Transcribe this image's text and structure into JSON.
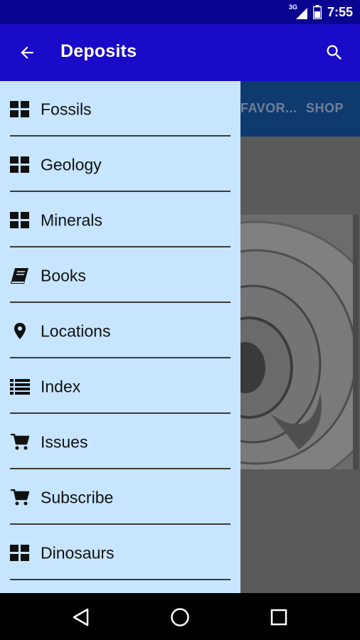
{
  "status_bar": {
    "network_label": "3G",
    "time": "7:55",
    "icons": [
      "signal-icon",
      "battery-icon"
    ]
  },
  "app_bar": {
    "title": "Deposits",
    "back_icon": "arrow-left-icon",
    "search_icon": "search-icon"
  },
  "tabs": [
    {
      "label": "FAVOR..."
    },
    {
      "label": "SHOP"
    }
  ],
  "drawer": {
    "items": [
      {
        "label": "Fossils",
        "icon": "grid-icon"
      },
      {
        "label": "Geology",
        "icon": "grid-icon"
      },
      {
        "label": "Minerals",
        "icon": "grid-icon"
      },
      {
        "label": "Books",
        "icon": "book-icon"
      },
      {
        "label": "Locations",
        "icon": "location-pin-icon"
      },
      {
        "label": "Index",
        "icon": "list-icon"
      },
      {
        "label": "Issues",
        "icon": "cart-icon"
      },
      {
        "label": "Subscribe",
        "icon": "cart-icon"
      },
      {
        "label": "Dinosaurs",
        "icon": "grid-icon"
      }
    ]
  },
  "nav_bar": {
    "back_icon": "nav-back-icon",
    "home_icon": "nav-home-icon",
    "recents_icon": "nav-recents-icon"
  },
  "colors": {
    "status_bar": "#0a0590",
    "app_bar": "#1a0bc8",
    "drawer_bg": "#c7e5ff",
    "tab_strip": "#0e3a6e"
  }
}
